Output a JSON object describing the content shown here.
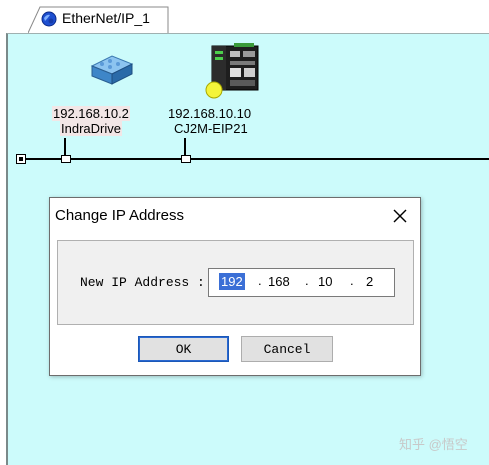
{
  "tab": {
    "label": "EtherNet/IP_1",
    "icon": "network-globe-icon"
  },
  "network": {
    "nodes": [
      {
        "ip": "192.168.10.2",
        "name": "IndraDrive",
        "icon": "drive-device-icon"
      },
      {
        "ip": "192.168.10.10",
        "name": "CJ2M-EIP21",
        "icon": "plc-device-icon"
      }
    ]
  },
  "dialog": {
    "title": "Change IP Address",
    "close_icon": "close-icon",
    "field_label": "New IP Address :",
    "ip": {
      "o1": "192",
      "o2": "168",
      "o3": "10",
      "o4": "2"
    },
    "ok_label": "OK",
    "cancel_label": "Cancel"
  },
  "watermark": "知乎 @悟空",
  "colors": {
    "canvas_bg": "#ccfbfb",
    "selection": "#3b6fd6",
    "default_button_border": "#1b58b8"
  }
}
